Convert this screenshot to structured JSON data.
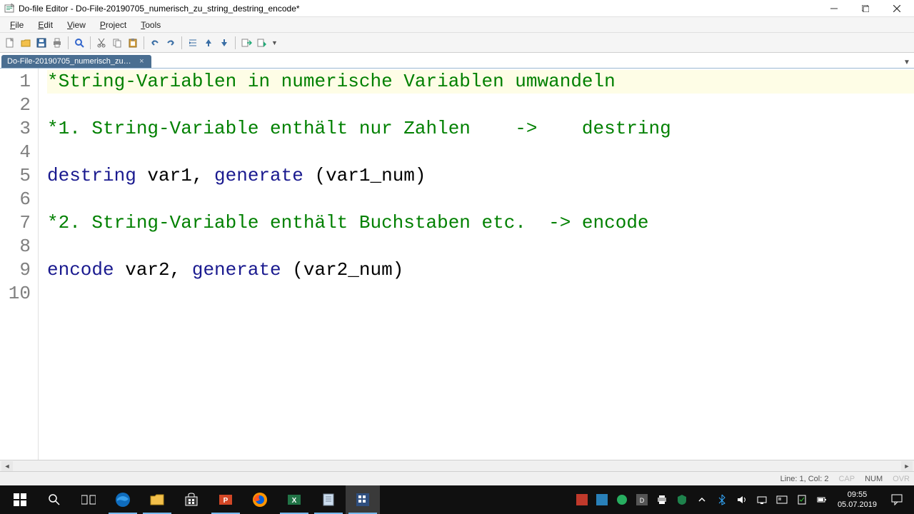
{
  "window": {
    "title": "Do-file Editor - Do-File-20190705_numerisch_zu_string_destring_encode*"
  },
  "menu": {
    "file": "File",
    "edit": "Edit",
    "view": "View",
    "project": "Project",
    "tools": "Tools"
  },
  "tab": {
    "label": "Do-File-20190705_numerisch_zu_st...",
    "close": "×"
  },
  "code": {
    "lines": [
      {
        "num": "1",
        "type": "comment",
        "text": "*String-Variablen in numerische Variablen umwandeln"
      },
      {
        "num": "2",
        "type": "blank",
        "text": ""
      },
      {
        "num": "3",
        "type": "comment",
        "text": "*1. String-Variable enthält nur Zahlen    ->    destring"
      },
      {
        "num": "4",
        "type": "blank",
        "text": ""
      },
      {
        "num": "5",
        "type": "stmt",
        "cmd1": "destring",
        "mid": " var1, ",
        "cmd2": "generate",
        "rest": " (var1_num)"
      },
      {
        "num": "6",
        "type": "blank",
        "text": ""
      },
      {
        "num": "7",
        "type": "comment",
        "text": "*2. String-Variable enthält Buchstaben etc.  -> encode"
      },
      {
        "num": "8",
        "type": "blank",
        "text": ""
      },
      {
        "num": "9",
        "type": "stmt",
        "cmd1": "encode",
        "mid": " var2, ",
        "cmd2": "generate",
        "rest": " (var2_num)"
      },
      {
        "num": "10",
        "type": "blank",
        "text": ""
      }
    ]
  },
  "status": {
    "pos": "Line: 1, Col: 2",
    "cap": "CAP",
    "num": "NUM",
    "ovr": "OVR"
  },
  "taskbar": {
    "time": "09:55",
    "date": "05.07.2019"
  }
}
